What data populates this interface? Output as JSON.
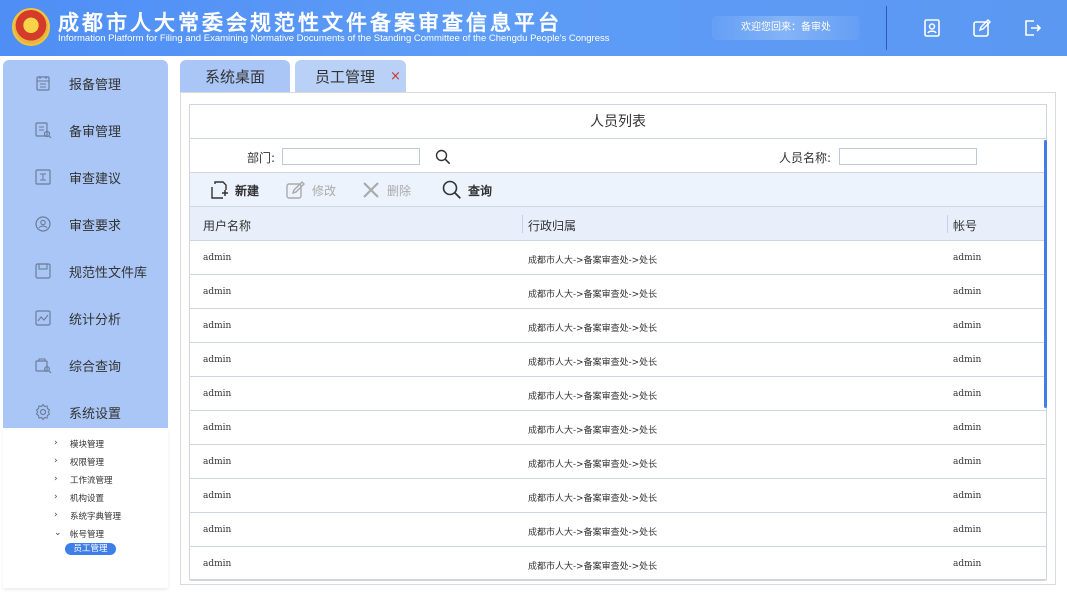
{
  "header": {
    "title_cn": "成都市人大常委会规范性文件备案审查信息平台",
    "title_en": "Information Platform for Filing and Examining Normative Documents of the Standing Committee of the Chengdu People's Congress",
    "welcome": "欢迎您回来：备审处",
    "icons": [
      "profile-icon",
      "edit-icon",
      "logout-icon"
    ]
  },
  "sidebar": {
    "items": [
      {
        "label": "报备管理",
        "icon": "calendar-icon"
      },
      {
        "label": "备审管理",
        "icon": "document-review-icon"
      },
      {
        "label": "审查建议",
        "icon": "suggestion-icon"
      },
      {
        "label": "审查要求",
        "icon": "user-circle-icon"
      },
      {
        "label": "规范性文件库",
        "icon": "save-icon"
      },
      {
        "label": "统计分析",
        "icon": "chart-icon"
      },
      {
        "label": "综合查询",
        "icon": "search-doc-icon"
      },
      {
        "label": "系统设置",
        "icon": "gear-icon"
      }
    ],
    "sub_items": [
      {
        "label": "模块管理",
        "chevron": "›"
      },
      {
        "label": "权限管理",
        "chevron": "›"
      },
      {
        "label": "工作流管理",
        "chevron": "›"
      },
      {
        "label": "机构设置",
        "chevron": "›"
      },
      {
        "label": "系统字典管理",
        "chevron": "›"
      },
      {
        "label": "帐号管理",
        "chevron": "⌄"
      }
    ],
    "active_sub": "员工管理"
  },
  "tabs": [
    {
      "label": "系统桌面"
    },
    {
      "label": "员工管理",
      "close": "×"
    }
  ],
  "panel": {
    "title": "人员列表",
    "filter": {
      "dept_label": "部门:",
      "dept_value": "",
      "name_label": "人员名称:",
      "name_value": ""
    },
    "toolbar": {
      "new": "新建",
      "edit": "修改",
      "delete": "删除",
      "query": "查询"
    },
    "columns": [
      "用户名称",
      "行政归属",
      "帐号"
    ],
    "rows": [
      [
        "admin",
        "成都市人大->备案审查处->处长",
        "admin"
      ],
      [
        "admin",
        "成都市人大->备案审查处->处长",
        "admin"
      ],
      [
        "admin",
        "成都市人大->备案审查处->处长",
        "admin"
      ],
      [
        "admin",
        "成都市人大->备案审查处->处长",
        "admin"
      ],
      [
        "admin",
        "成都市人大->备案审查处->处长",
        "admin"
      ],
      [
        "admin",
        "成都市人大->备案审查处->处长",
        "admin"
      ],
      [
        "admin",
        "成都市人大->备案审查处->处长",
        "admin"
      ],
      [
        "admin",
        "成都市人大->备案审查处->处长",
        "admin"
      ],
      [
        "admin",
        "成都市人大->备案审查处->处长",
        "admin"
      ],
      [
        "admin",
        "成都市人大->备案审查处->处长",
        "admin"
      ]
    ]
  },
  "colors": {
    "header_blue": "#4f8ef5",
    "sidebar_blue": "#a9c6f6",
    "active_blue": "#3f7ee8",
    "close_red": "#d0342b"
  }
}
